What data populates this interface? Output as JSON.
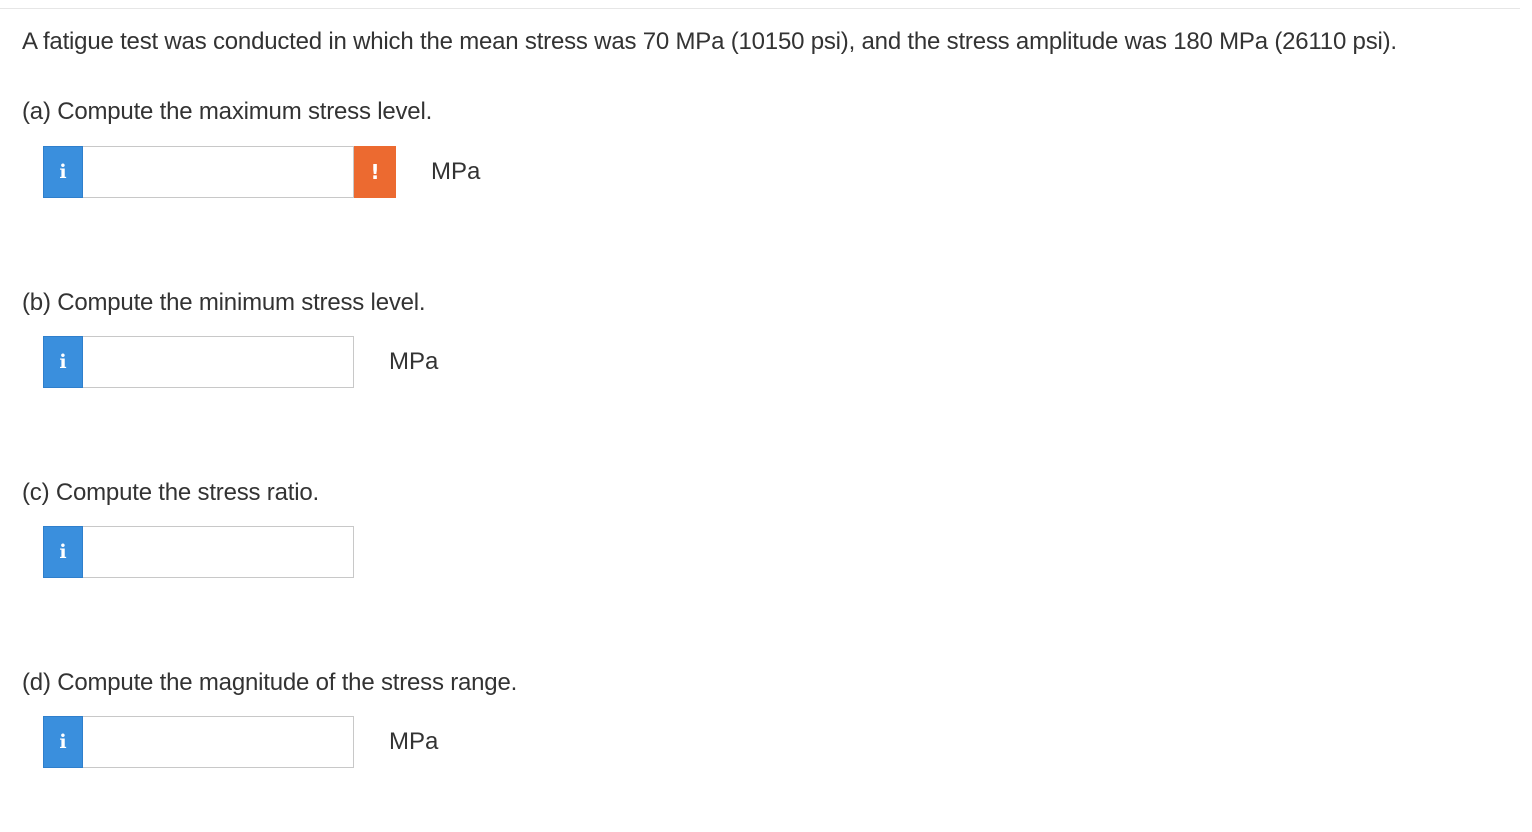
{
  "problem": {
    "text": "A fatigue test was conducted in which the mean stress was 70 MPa (10150 psi), and the stress amplitude was 180 MPa (26110 psi)."
  },
  "parts": [
    {
      "label": "(a) Compute the maximum stress level.",
      "value": "",
      "unit": "MPa",
      "has_warning": true,
      "warning_glyph": "!"
    },
    {
      "label": "(b) Compute the minimum stress level.",
      "value": "",
      "unit": "MPa",
      "has_warning": false
    },
    {
      "label": "(c) Compute the stress ratio.",
      "value": "",
      "unit": "",
      "has_warning": false
    },
    {
      "label": "(d) Compute the magnitude of the stress range.",
      "value": "",
      "unit": "MPa",
      "has_warning": false
    }
  ],
  "info_glyph": "i",
  "colors": {
    "info_button": "#3a8fdd",
    "warning_button": "#ec6a30",
    "text": "#333333",
    "input_border": "#c8c8c8"
  }
}
